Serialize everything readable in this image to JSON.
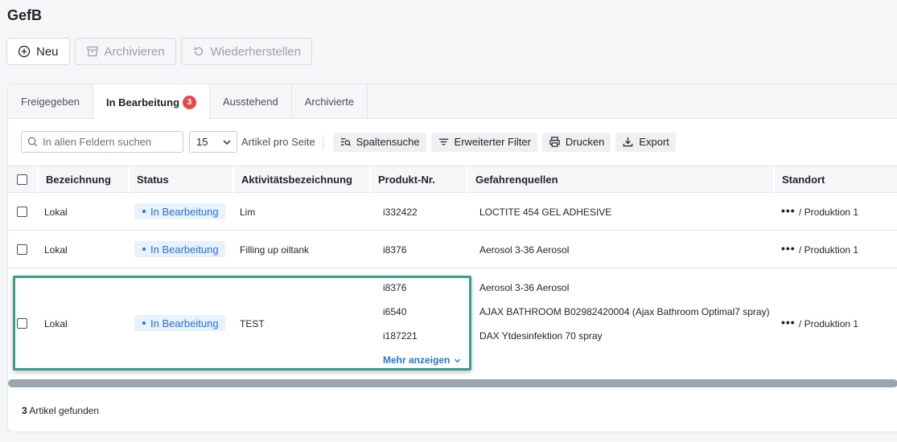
{
  "app": {
    "title": "GefB"
  },
  "toolbar": {
    "new_label": "Neu",
    "archive_label": "Archivieren",
    "restore_label": "Wiederherstellen"
  },
  "tabs": [
    {
      "label": "Freigegeben",
      "active": false
    },
    {
      "label": "In Bearbeitung",
      "active": true,
      "badge": "3"
    },
    {
      "label": "Ausstehend",
      "active": false
    },
    {
      "label": "Archivierte",
      "active": false
    }
  ],
  "filters": {
    "search_placeholder": "In allen Feldern suchen",
    "per_page_value": "15",
    "per_page_label": "Artikel pro Seite",
    "column_search_label": "Spaltensuche",
    "advanced_filter_label": "Erweiterter Filter",
    "print_label": "Drucken",
    "export_label": "Export"
  },
  "table": {
    "columns": [
      "Bezeichnung",
      "Status",
      "Aktivitätsbezeichnung",
      "Produkt-Nr.",
      "Gefahrenquellen",
      "Standort"
    ],
    "rows": [
      {
        "name": "Lokal",
        "status": "In Bearbeitung",
        "activity": "Lim",
        "products": [
          "i332422"
        ],
        "hazards": [
          "LOCTITE 454 GEL ADHESIVE"
        ],
        "location_prefix": "•••",
        "location": "/ Produktion 1"
      },
      {
        "name": "Lokal",
        "status": "In Bearbeitung",
        "activity": "Filling up oiltank",
        "products": [
          "i8376"
        ],
        "hazards": [
          "Aerosol 3-36 Aerosol"
        ],
        "location_prefix": "•••",
        "location": "/ Produktion 1"
      },
      {
        "name": "Lokal",
        "status": "In Bearbeitung",
        "activity": "TEST",
        "products": [
          "i8376",
          "i6540",
          "i187221"
        ],
        "hazards": [
          "Aerosol 3-36 Aerosol",
          "AJAX BATHROOM B02982420004 (Ajax Bathroom Optimal7 spray)",
          "DAX Ytdesinfektion 70 spray"
        ],
        "more_label": "Mehr anzeigen",
        "location_prefix": "•••",
        "location": "/ Produktion 1"
      }
    ]
  },
  "footer": {
    "count": "3",
    "label": "Artikel gefunden"
  },
  "colors": {
    "accent": "#2574d4",
    "badge": "#e5484d",
    "highlight": "#3a9d8a"
  }
}
